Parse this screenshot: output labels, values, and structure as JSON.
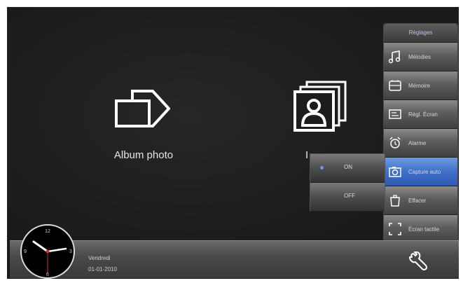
{
  "home": {
    "album_label": "Album photo",
    "partial_label": "I"
  },
  "settings_menu": {
    "title": "Réglages",
    "items": [
      {
        "label": "Mélodies",
        "icon": "music-note-icon"
      },
      {
        "label": "Mémoire",
        "icon": "memory-card-icon"
      },
      {
        "label": "Régl. Écran",
        "icon": "screen-icon"
      },
      {
        "label": "Alarme",
        "icon": "alarm-icon"
      },
      {
        "label": "Capture auto",
        "icon": "camera-icon"
      },
      {
        "label": "Effacer",
        "icon": "delete-icon"
      },
      {
        "label": "Écran tactile",
        "icon": "touch-screen-icon"
      }
    ],
    "active_index": 4
  },
  "capture_submenu": {
    "options": [
      {
        "label": "ON"
      },
      {
        "label": "OFF"
      }
    ],
    "selected": "ON"
  },
  "status_bar": {
    "day": "Vendredi",
    "date": "01-01-2010"
  },
  "clock": {
    "labels": [
      "12",
      "3",
      "6",
      "9"
    ],
    "time": "10:15"
  },
  "colors": {
    "background": "#1c1c1c",
    "accent": "#3f70c8"
  }
}
